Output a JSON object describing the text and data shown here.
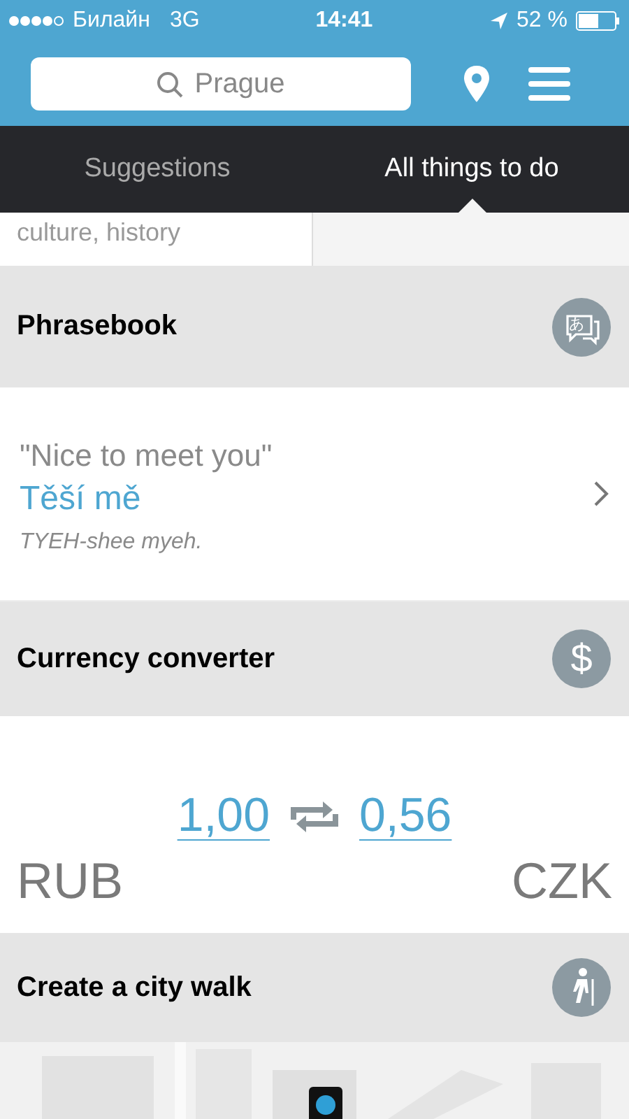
{
  "status_bar": {
    "carrier": "Билайн",
    "network": "3G",
    "time": "14:41",
    "battery": "52 %"
  },
  "search": {
    "value": "Prague"
  },
  "tabs": [
    {
      "label": "Suggestions",
      "selected": false
    },
    {
      "label": "All things to do",
      "selected": true
    }
  ],
  "partial_card": {
    "subtitle": "culture, history"
  },
  "sections": [
    {
      "kind": "phrasebook",
      "title": "Phrasebook",
      "icon_glyph": "あ",
      "phrase": {
        "english": "\"Nice to meet you\"",
        "czech": "Těší mě",
        "pronunciation": "TYEH-shee myeh."
      }
    },
    {
      "kind": "currency",
      "title": "Currency converter",
      "icon_glyph": "$",
      "converter": {
        "from_amount": "1,00",
        "to_amount": "0,56",
        "from_currency": "RUB",
        "to_currency": "CZK"
      }
    },
    {
      "kind": "city_walk",
      "title": "Create a city walk"
    }
  ]
}
